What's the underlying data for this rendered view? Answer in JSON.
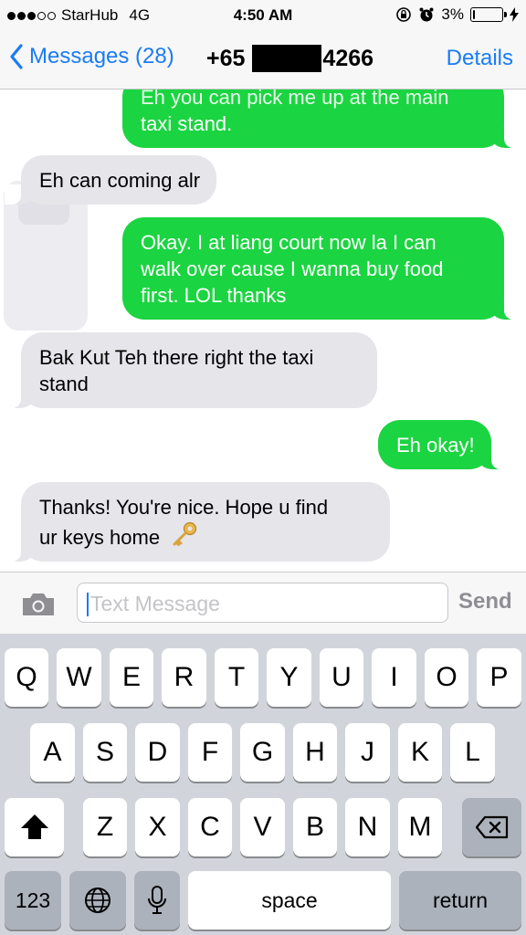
{
  "status_bar": {
    "carrier": "StarHub",
    "network": "4G",
    "time": "4:50 AM",
    "battery_percent": "3%",
    "battery_level": 0.03,
    "icons": [
      "signal-dots-icon",
      "orientation-lock-icon",
      "alarm-icon",
      "battery-icon",
      "charging-bolt-icon"
    ]
  },
  "nav": {
    "back_label": "Messages (28)",
    "contact_prefix": "+65",
    "contact_suffix": "4266",
    "details_label": "Details"
  },
  "messages": [
    {
      "side": "sent",
      "text_top": "Eh you can pick me up at the main",
      "text": "taxi stand."
    },
    {
      "side": "received",
      "text": "Eh can coming alr"
    },
    {
      "side": "sent",
      "lines": [
        "Okay. I at liang court now la I can",
        "walk over cause I wanna buy food",
        "first. LOL thanks"
      ]
    },
    {
      "side": "received",
      "lines": [
        "Bak Kut Teh there right the taxi",
        "stand"
      ]
    },
    {
      "side": "sent",
      "text": "Eh okay!"
    },
    {
      "side": "received",
      "lines": [
        "Thanks! You're nice. Hope u find",
        "ur keys home"
      ],
      "emoji": "key-emoji"
    }
  ],
  "input": {
    "placeholder": "Text Message",
    "send_label": "Send",
    "camera_icon": "camera-icon"
  },
  "keyboard": {
    "row1": [
      "Q",
      "W",
      "E",
      "R",
      "T",
      "Y",
      "U",
      "I",
      "O",
      "P"
    ],
    "row2": [
      "A",
      "S",
      "D",
      "F",
      "G",
      "H",
      "J",
      "K",
      "L"
    ],
    "row3": [
      "Z",
      "X",
      "C",
      "V",
      "B",
      "N",
      "M"
    ],
    "numbers_label": "123",
    "space_label": "space",
    "return_label": "return",
    "icons": [
      "shift-icon",
      "delete-icon",
      "globe-icon",
      "microphone-icon"
    ]
  },
  "colors": {
    "sent_bubble": "#1bd441",
    "received_bubble": "#e5e5ea",
    "accent": "#1a7cf5",
    "keyboard_bg": "#d1d5db"
  }
}
